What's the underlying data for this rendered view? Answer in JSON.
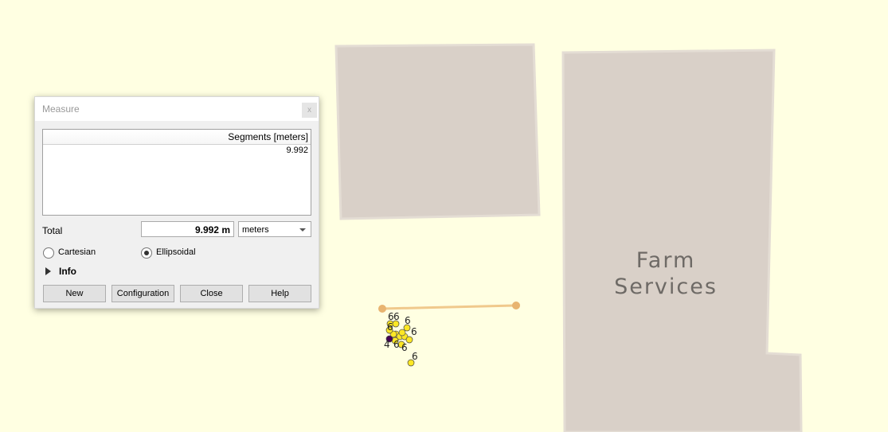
{
  "map": {
    "background": "#ffffe2",
    "building_color": "#d9d0c8",
    "building_label": [
      "Farm",
      "Services"
    ],
    "measure_line_color": "#f0c98c",
    "points": [
      {
        "label": "6",
        "color": "#fde725"
      },
      {
        "label": "6",
        "color": "#fde725"
      },
      {
        "label": "6",
        "color": "#fde725"
      },
      {
        "label": "6",
        "color": "#fde725"
      },
      {
        "label": "6",
        "color": "#fde725"
      },
      {
        "label": "6",
        "color": "#fde725"
      },
      {
        "label": "6",
        "color": "#fde725"
      },
      {
        "label": "4",
        "color": "#440154"
      },
      {
        "label": "6",
        "color": "#fde725"
      }
    ]
  },
  "dialog": {
    "title": "Measure",
    "close_x": "x",
    "table_header": "Segments [meters]",
    "segments": [
      "9.992"
    ],
    "total_label": "Total",
    "total_value": "9.992 m",
    "unit_selected": "meters",
    "radio_cartesian": "Cartesian",
    "radio_ellipsoidal": "Ellipsoidal",
    "selected_mode": "Ellipsoidal",
    "info_label": "Info",
    "buttons": {
      "new": "New",
      "configuration": "Configuration",
      "close": "Close",
      "help": "Help"
    }
  }
}
